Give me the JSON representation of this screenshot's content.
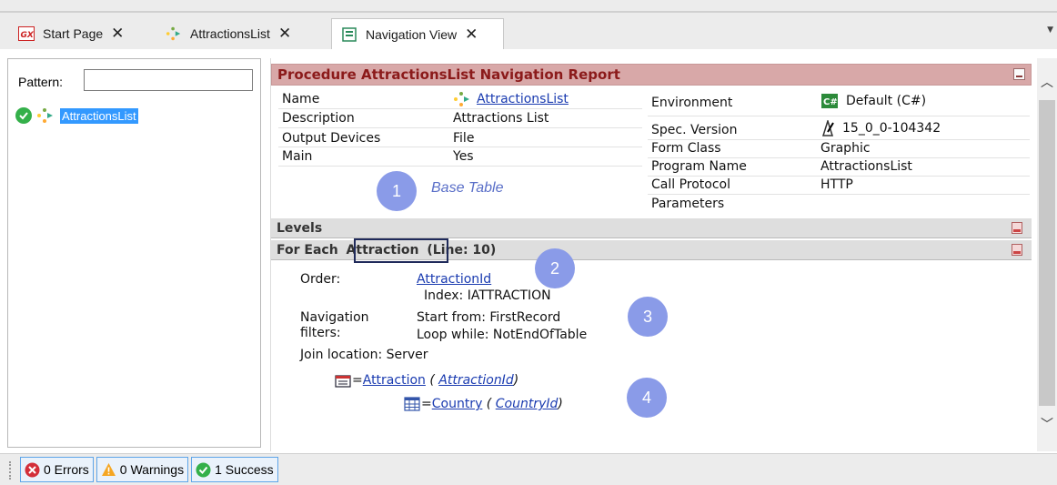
{
  "tabs": [
    {
      "label": "Start Page",
      "icon": "gx-icon",
      "active": false
    },
    {
      "label": "AttractionsList",
      "icon": "procedure-icon",
      "active": false
    },
    {
      "label": "Navigation View",
      "icon": "navigation-view-icon",
      "active": true
    }
  ],
  "left_panel": {
    "pattern_label": "Pattern:",
    "pattern_value": "",
    "tree_item": "AttractionsList"
  },
  "report": {
    "title": "Procedure AttractionsList Navigation Report",
    "left_props": [
      {
        "key": "Name",
        "value": "AttractionsList"
      },
      {
        "key": "Description",
        "value": "Attractions List"
      },
      {
        "key": "Output Devices",
        "value": "File"
      },
      {
        "key": "Main",
        "value": "Yes"
      }
    ],
    "right_props": [
      {
        "key": "Environment",
        "value": "Default (C#)"
      },
      {
        "key": "Spec. Version",
        "value": "15_0_0-104342"
      },
      {
        "key": "Form Class",
        "value": "Graphic"
      },
      {
        "key": "Program Name",
        "value": "AttractionsList"
      },
      {
        "key": "Call Protocol",
        "value": "HTTP"
      },
      {
        "key": "Parameters",
        "value": ""
      }
    ],
    "levels_label": "Levels",
    "for_each": {
      "prefix": "For Each",
      "table": "Attraction",
      "line": "(Line: 10)"
    },
    "order_label": "Order:",
    "order_value": "AttractionId",
    "index_text": "Index: IATTRACTION",
    "nav_filters_label_1": "Navigation",
    "nav_filters_label_2": "filters:",
    "start_from": "Start from: FirstRecord",
    "loop_while": "Loop while: NotEndOfTable",
    "join_location": "Join location:  Server",
    "join1": {
      "eq": "=",
      "table": "Attraction",
      "open": " ( ",
      "key": "AttractionId",
      "close": ")"
    },
    "join2": {
      "eq": "=",
      "table": "Country",
      "open": " ( ",
      "key": "CountryId",
      "close": ")"
    }
  },
  "annotations": {
    "bubble1": "1",
    "bubble1_text": "Base Table",
    "bubble2": "2",
    "bubble3": "3",
    "bubble4": "4"
  },
  "statusbar": {
    "errors": "0 Errors",
    "warnings": "0 Warnings",
    "success": "1 Success"
  },
  "colors": {
    "report_header_bg": "#d8a8a8",
    "report_header_text": "#8b1a1a",
    "annotation_bubble": "#8a9be8",
    "selection": "#3399ff",
    "success_green": "#34b04a",
    "link_blue": "#1a3bb0"
  }
}
